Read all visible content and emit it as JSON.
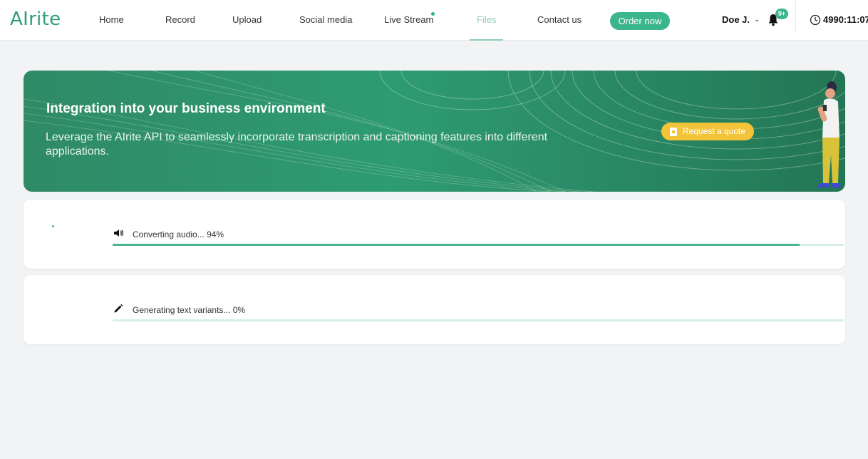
{
  "app": {
    "logo_prefix": "AI",
    "logo_suffix": "rite"
  },
  "nav": {
    "items": [
      {
        "label": "Home"
      },
      {
        "label": "Record"
      },
      {
        "label": "Upload"
      },
      {
        "label": "Social media"
      },
      {
        "label": "Live Stream"
      },
      {
        "label": "Files",
        "active": true
      },
      {
        "label": "Contact us"
      }
    ],
    "order_label": "Order now",
    "user_name": "Doe J.",
    "notification_badge": "9+",
    "timer": "4990:11:07"
  },
  "banner": {
    "title": "Integration into your business environment",
    "text": "Leverage the AIrite API to seamlessly incorporate transcription and captioning features into different applications.",
    "button_label": "Request a quote"
  },
  "progress": [
    {
      "label": "Converting audio... 94%",
      "icon": "speaker-icon",
      "value": 0.94
    },
    {
      "label": "Generating text variants... 0%",
      "icon": "pencil-icon",
      "value": 0.0
    }
  ],
  "colors": {
    "accent": "#3bb58b",
    "banner": "#2e9b74",
    "quote_button": "#f3c437"
  }
}
